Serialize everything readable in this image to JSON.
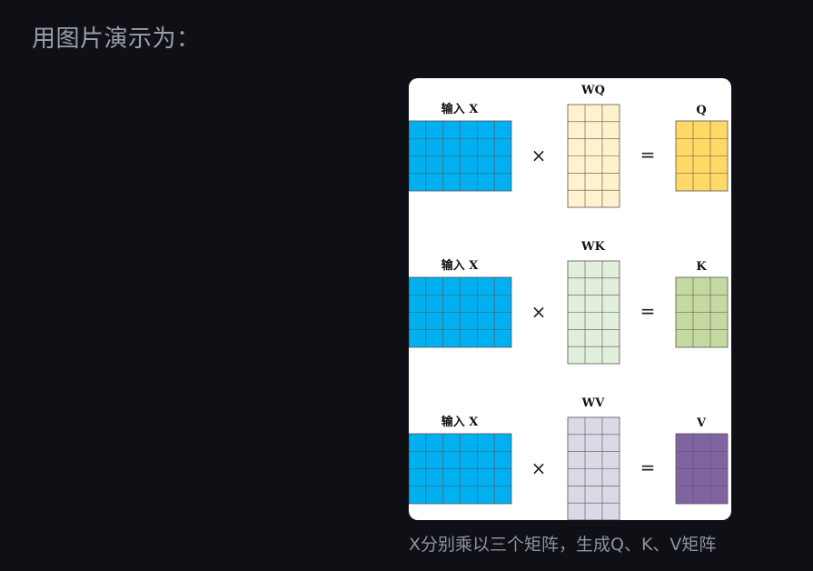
{
  "heading": "用图片演示为：",
  "caption": "X分别乘以三个矩阵，生成Q、K、V矩阵",
  "rows": [
    {
      "input_label": "输入  X",
      "weight_label": "WQ",
      "output_label": "Q",
      "multiply_symbol": "×",
      "equals_symbol": "=",
      "input_color": "#00b0f0",
      "weight_color": "#fff2cc",
      "output_color": "#ffd966"
    },
    {
      "input_label": "输入  X",
      "weight_label": "WK",
      "output_label": "K",
      "multiply_symbol": "×",
      "equals_symbol": "=",
      "input_color": "#00b0f0",
      "weight_color": "#e2efda",
      "output_color": "#c5d9a0"
    },
    {
      "input_label": "输入  X",
      "weight_label": "WV",
      "output_label": "V",
      "multiply_symbol": "×",
      "equals_symbol": "=",
      "input_color": "#00b0f0",
      "weight_color": "#ddd8e6",
      "output_color": "#8064a2"
    }
  ]
}
